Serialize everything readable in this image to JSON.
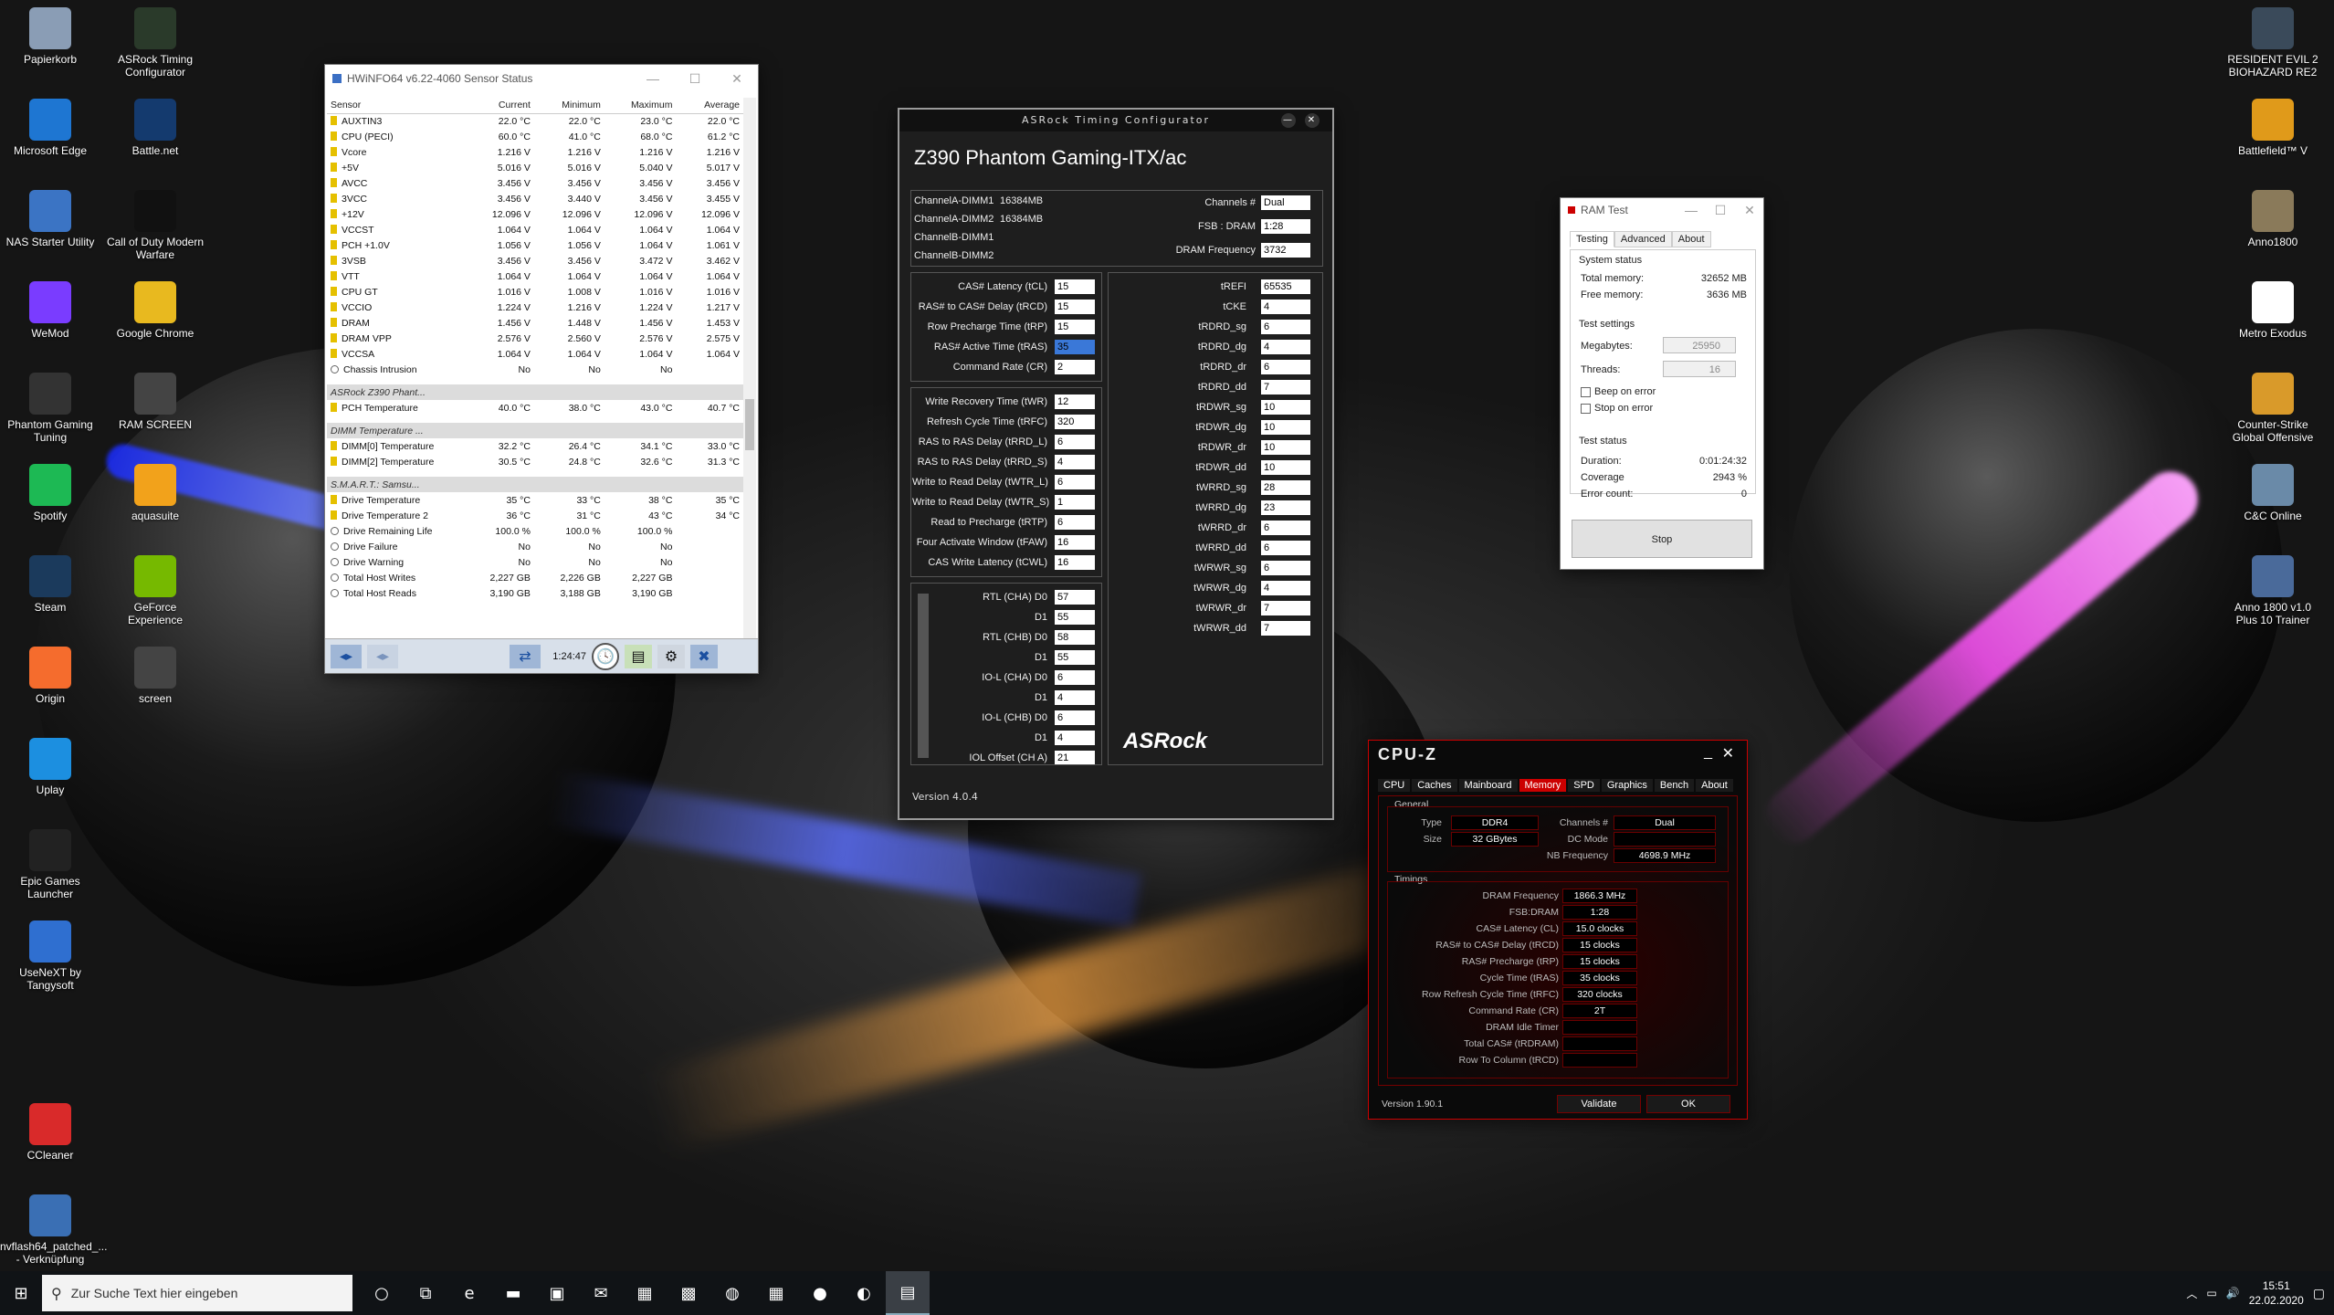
{
  "desktop": {
    "left_icons": [
      {
        "label": "Papierkorb",
        "icon": "recycle-bin-icon",
        "color": "#8a9db5"
      },
      {
        "label": "ASRock Timing Configurator",
        "icon": "asrock-icon",
        "color": "#2a3a2a"
      },
      {
        "label": "Microsoft Edge",
        "icon": "edge-icon",
        "color": "#1e76d2"
      },
      {
        "label": "Battle.net",
        "icon": "battlenet-icon",
        "color": "#143a6e"
      },
      {
        "label": "NAS Starter Utility",
        "icon": "nas-icon",
        "color": "#3b74c4"
      },
      {
        "label": "Call of Duty Modern Warfare",
        "icon": "cod-icon",
        "color": "#111111"
      },
      {
        "label": "WeMod",
        "icon": "wemod-icon",
        "color": "#7a3cff"
      },
      {
        "label": "Google Chrome",
        "icon": "chrome-icon",
        "color": "#e8b91f"
      },
      {
        "label": "Phantom Gaming Tuning",
        "icon": "phantom-icon",
        "color": "#333333"
      },
      {
        "label": "RAM SCREEN",
        "icon": "screenshot-icon",
        "color": "#444444"
      },
      {
        "label": "Spotify",
        "icon": "spotify-icon",
        "color": "#1db954"
      },
      {
        "label": "aquasuite",
        "icon": "aquasuite-icon",
        "color": "#f2a21b"
      },
      {
        "label": "Steam",
        "icon": "steam-icon",
        "color": "#1b3a5c"
      },
      {
        "label": "GeForce Experience",
        "icon": "geforce-icon",
        "color": "#76b900"
      },
      {
        "label": "Origin",
        "icon": "origin-icon",
        "color": "#f56c2d"
      },
      {
        "label": "screen",
        "icon": "screenshot-icon",
        "color": "#444444"
      },
      {
        "label": "Uplay",
        "icon": "uplay-icon",
        "color": "#1c8fe0"
      },
      {
        "label": "Epic Games Launcher",
        "icon": "epic-icon",
        "color": "#222222"
      },
      {
        "label": "UseNeXT by Tangysoft",
        "icon": "usenext-icon",
        "color": "#2f6fd0"
      },
      {
        "label": "CCleaner",
        "icon": "ccleaner-icon",
        "color": "#d92a2a"
      },
      {
        "label": "nvflash64_patched_... - Verknüpfung",
        "icon": "nvflash-icon",
        "color": "#3a6fb4"
      }
    ],
    "right_icons": [
      {
        "label": "RESIDENT EVIL 2 BIOHAZARD RE2",
        "icon": "re2-icon",
        "color": "#3a4a5a"
      },
      {
        "label": "Battlefield™ V",
        "icon": "battlefield-icon",
        "color": "#e09a1a"
      },
      {
        "label": "Anno1800",
        "icon": "anno-icon",
        "color": "#8a7a5a"
      },
      {
        "label": "Metro Exodus",
        "icon": "metro-icon",
        "color": "#ffffff"
      },
      {
        "label": "Counter-Strike Global Offensive",
        "icon": "csgo-icon",
        "color": "#d99a2a"
      },
      {
        "label": "C&C Online",
        "icon": "cnc-icon",
        "color": "#6a8aa8"
      },
      {
        "label": "Anno 1800 v1.0 Plus 10 Trainer",
        "icon": "trainer-icon",
        "color": "#4a6a9a"
      }
    ]
  },
  "hwinfo": {
    "title": "HWiNFO64 v6.22-4060 Sensor Status",
    "columns": [
      "Sensor",
      "Current",
      "Minimum",
      "Maximum",
      "Average"
    ],
    "rows": [
      [
        "AUXTIN3",
        "22.0 °C",
        "22.0 °C",
        "23.0 °C",
        "22.0 °C"
      ],
      [
        "CPU (PECI)",
        "60.0 °C",
        "41.0 °C",
        "68.0 °C",
        "61.2 °C"
      ],
      [
        "Vcore",
        "1.216 V",
        "1.216 V",
        "1.216 V",
        "1.216 V"
      ],
      [
        "+5V",
        "5.016 V",
        "5.016 V",
        "5.040 V",
        "5.017 V"
      ],
      [
        "AVCC",
        "3.456 V",
        "3.456 V",
        "3.456 V",
        "3.456 V"
      ],
      [
        "3VCC",
        "3.456 V",
        "3.440 V",
        "3.456 V",
        "3.455 V"
      ],
      [
        "+12V",
        "12.096 V",
        "12.096 V",
        "12.096 V",
        "12.096 V"
      ],
      [
        "VCCST",
        "1.064 V",
        "1.064 V",
        "1.064 V",
        "1.064 V"
      ],
      [
        "PCH +1.0V",
        "1.056 V",
        "1.056 V",
        "1.064 V",
        "1.061 V"
      ],
      [
        "3VSB",
        "3.456 V",
        "3.456 V",
        "3.472 V",
        "3.462 V"
      ],
      [
        "VTT",
        "1.064 V",
        "1.064 V",
        "1.064 V",
        "1.064 V"
      ],
      [
        "CPU GT",
        "1.016 V",
        "1.008 V",
        "1.016 V",
        "1.016 V"
      ],
      [
        "VCCIO",
        "1.224 V",
        "1.216 V",
        "1.224 V",
        "1.217 V"
      ],
      [
        "DRAM",
        "1.456 V",
        "1.448 V",
        "1.456 V",
        "1.453 V"
      ],
      [
        "DRAM VPP",
        "2.576 V",
        "2.560 V",
        "2.576 V",
        "2.575 V"
      ],
      [
        "VCCSA",
        "1.064 V",
        "1.064 V",
        "1.064 V",
        "1.064 V"
      ],
      [
        "Chassis Intrusion",
        "No",
        "No",
        "No",
        ""
      ]
    ],
    "group2": "ASRock Z390 Phant...",
    "rows2": [
      [
        "PCH Temperature",
        "40.0 °C",
        "38.0 °C",
        "43.0 °C",
        "40.7 °C"
      ]
    ],
    "group3": "DIMM Temperature ...",
    "rows3": [
      [
        "DIMM[0] Temperature",
        "32.2 °C",
        "26.4 °C",
        "34.1 °C",
        "33.0 °C"
      ],
      [
        "DIMM[2] Temperature",
        "30.5 °C",
        "24.8 °C",
        "32.6 °C",
        "31.3 °C"
      ]
    ],
    "group4": "S.M.A.R.T.: Samsu...",
    "rows4": [
      [
        "Drive Temperature",
        "35 °C",
        "33 °C",
        "38 °C",
        "35 °C"
      ],
      [
        "Drive Temperature 2",
        "36 °C",
        "31 °C",
        "43 °C",
        "34 °C"
      ],
      [
        "Drive Remaining Life",
        "100.0 %",
        "100.0 %",
        "100.0 %",
        ""
      ],
      [
        "Drive Failure",
        "No",
        "No",
        "No",
        ""
      ],
      [
        "Drive Warning",
        "No",
        "No",
        "No",
        ""
      ],
      [
        "Total Host Writes",
        "2,227 GB",
        "2,226 GB",
        "2,227 GB",
        ""
      ],
      [
        "Total Host Reads",
        "3,190 GB",
        "3,188 GB",
        "3,190 GB",
        ""
      ]
    ],
    "timer": "1:24:47"
  },
  "asrock": {
    "title": "ASRock Timing Configurator",
    "board": "Z390 Phantom Gaming-ITX/ac",
    "dimms": [
      "ChannelA-DIMM1",
      "ChannelA-DIMM2",
      "ChannelB-DIMM1",
      "ChannelB-DIMM2"
    ],
    "dimm_sizes": [
      "16384MB",
      "16384MB",
      "",
      ""
    ],
    "channels_label": "Channels #",
    "channels": "Dual",
    "fsb_label": "FSB : DRAM",
    "fsb": "1:28",
    "freq_label": "DRAM Frequency",
    "freq": "3732",
    "primary": [
      [
        "CAS# Latency (tCL)",
        "15"
      ],
      [
        "RAS# to CAS# Delay (tRCD)",
        "15"
      ],
      [
        "Row Precharge Time (tRP)",
        "15"
      ],
      [
        "RAS# Active Time (tRAS)",
        "35"
      ],
      [
        "Command Rate (CR)",
        "2"
      ]
    ],
    "secondary": [
      [
        "Write Recovery Time (tWR)",
        "12"
      ],
      [
        "Refresh Cycle Time (tRFC)",
        "320"
      ],
      [
        "RAS to RAS Delay (tRRD_L)",
        "6"
      ],
      [
        "RAS to RAS Delay (tRRD_S)",
        "4"
      ],
      [
        "Write to Read Delay (tWTR_L)",
        "6"
      ],
      [
        "Write to Read Delay (tWTR_S)",
        "1"
      ],
      [
        "Read to Precharge (tRTP)",
        "6"
      ],
      [
        "Four Activate Window (tFAW)",
        "16"
      ],
      [
        "CAS Write Latency (tCWL)",
        "16"
      ]
    ],
    "rtl": [
      [
        "RTL (CHA) D0",
        "57"
      ],
      [
        "D1",
        "55"
      ],
      [
        "RTL (CHB) D0",
        "58"
      ],
      [
        "D1",
        "55"
      ],
      [
        "IO-L (CHA) D0",
        "6"
      ],
      [
        "D1",
        "4"
      ],
      [
        "IO-L (CHB) D0",
        "6"
      ],
      [
        "D1",
        "4"
      ],
      [
        "IOL Offset (CH A)",
        "21"
      ]
    ],
    "right": [
      [
        "tREFI",
        "65535"
      ],
      [
        "tCKE",
        "4"
      ],
      [
        "tRDRD_sg",
        "6"
      ],
      [
        "tRDRD_dg",
        "4"
      ],
      [
        "tRDRD_dr",
        "6"
      ],
      [
        "tRDRD_dd",
        "7"
      ],
      [
        "tRDWR_sg",
        "10"
      ],
      [
        "tRDWR_dg",
        "10"
      ],
      [
        "tRDWR_dr",
        "10"
      ],
      [
        "tRDWR_dd",
        "10"
      ],
      [
        "tWRRD_sg",
        "28"
      ],
      [
        "tWRRD_dg",
        "23"
      ],
      [
        "tWRRD_dr",
        "6"
      ],
      [
        "tWRRD_dd",
        "6"
      ],
      [
        "tWRWR_sg",
        "6"
      ],
      [
        "tWRWR_dg",
        "4"
      ],
      [
        "tWRWR_dr",
        "7"
      ],
      [
        "tWRWR_dd",
        "7"
      ]
    ],
    "logo": "ASRock",
    "version": "Version 4.0.4"
  },
  "ramtest": {
    "title": "RAM Test",
    "tabs": [
      "Testing",
      "Advanced",
      "About"
    ],
    "system_status": "System status",
    "total_label": "Total memory:",
    "total": "32652 MB",
    "free_label": "Free memory:",
    "free": "3636 MB",
    "settings": "Test settings",
    "mb_label": "Megabytes:",
    "mb": "25950",
    "threads_label": "Threads:",
    "threads": "16",
    "beep": "Beep on error",
    "stop_on_error": "Stop on error",
    "status": "Test status",
    "duration_label": "Duration:",
    "duration": "0:01:24:32",
    "coverage_label": "Coverage",
    "coverage": "2943 %",
    "errors_label": "Error count:",
    "errors": "0",
    "stop": "Stop"
  },
  "cpuz": {
    "title": "CPU-Z",
    "tabs": [
      "CPU",
      "Caches",
      "Mainboard",
      "Memory",
      "SPD",
      "Graphics",
      "Bench",
      "About"
    ],
    "active_tab": "Memory",
    "general": "General",
    "type_label": "Type",
    "type": "DDR4",
    "size_label": "Size",
    "size": "32 GBytes",
    "channels_label": "Channels #",
    "channels": "Dual",
    "dcmode_label": "DC Mode",
    "dcmode": "",
    "nbfreq_label": "NB Frequency",
    "nbfreq": "4698.9 MHz",
    "timings": "Timings",
    "trows": [
      [
        "DRAM Frequency",
        "1866.3 MHz"
      ],
      [
        "FSB:DRAM",
        "1:28"
      ],
      [
        "CAS# Latency (CL)",
        "15.0 clocks"
      ],
      [
        "RAS# to CAS# Delay (tRCD)",
        "15 clocks"
      ],
      [
        "RAS# Precharge (tRP)",
        "15 clocks"
      ],
      [
        "Cycle Time (tRAS)",
        "35 clocks"
      ],
      [
        "Row Refresh Cycle Time (tRFC)",
        "320 clocks"
      ],
      [
        "Command Rate (CR)",
        "2T"
      ],
      [
        "DRAM Idle Timer",
        ""
      ],
      [
        "Total CAS# (tRDRAM)",
        ""
      ],
      [
        "Row To Column (tRCD)",
        ""
      ]
    ],
    "version": "Version 1.90.1",
    "validate": "Validate",
    "ok": "OK"
  },
  "taskbar": {
    "search_placeholder": "Zur Suche Text hier eingeben",
    "time": "15:51",
    "date": "22.02.2020"
  }
}
